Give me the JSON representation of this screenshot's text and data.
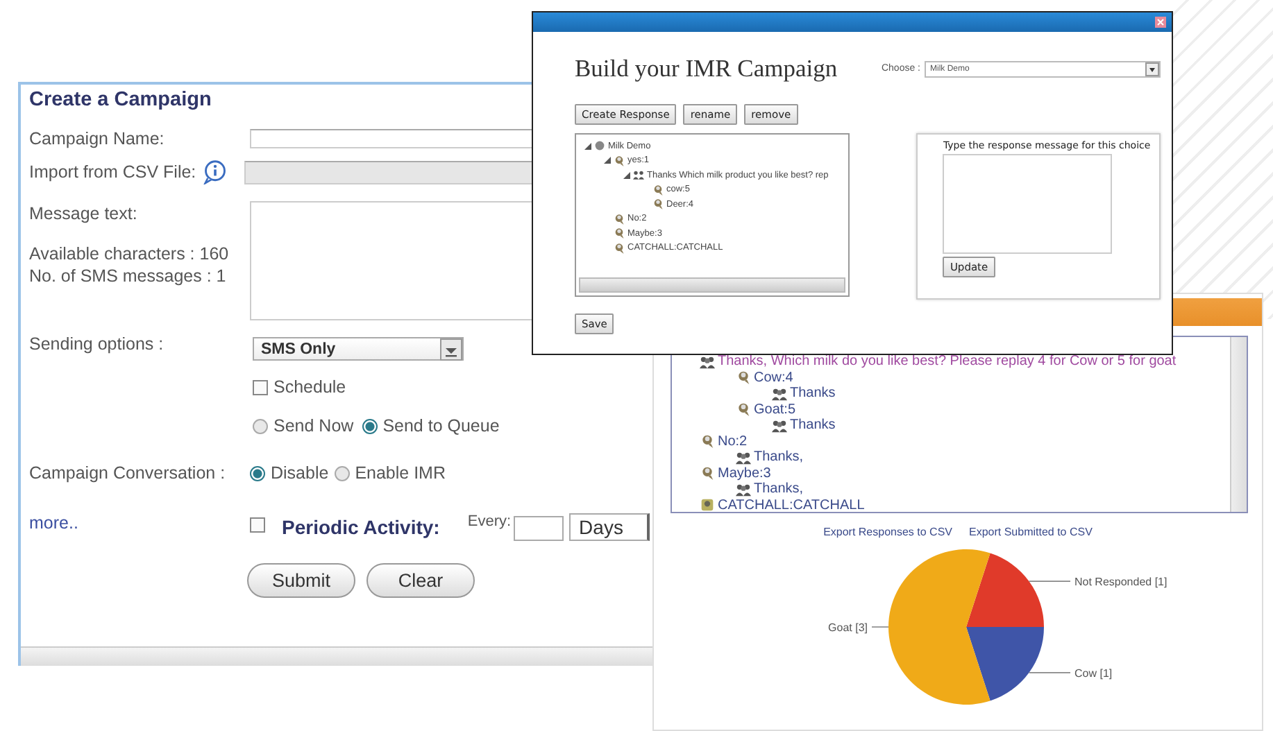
{
  "campaign_form": {
    "title": "Create a Campaign",
    "campaign_name": {
      "label": "Campaign Name:"
    },
    "import_csv": {
      "label": "Import from CSV File:"
    },
    "message": {
      "label": "Message text:",
      "available": "Available characters : 160",
      "sms_count": "No. of SMS messages : 1"
    },
    "sending_options": {
      "label": "Sending options :",
      "value": "SMS Only"
    },
    "schedule": {
      "label": "Schedule",
      "checked": false
    },
    "send_mode": [
      {
        "label": "Send Now",
        "selected": false
      },
      {
        "label": "Send to Queue",
        "selected": true
      }
    ],
    "conversation": {
      "label": "Campaign Conversation :",
      "options": [
        {
          "label": "Disable",
          "selected": true
        },
        {
          "label": "Enable IMR",
          "selected": false
        }
      ]
    },
    "more_link": "more..",
    "periodic": {
      "label": "Periodic Activity:",
      "checked": false,
      "every_label": "Every:",
      "unit": "Days"
    },
    "buttons": [
      "Submit",
      "Clear"
    ]
  },
  "imr_dialog": {
    "title": "Build your IMR Campaign",
    "choose_label": "Choose :",
    "choose_value": "Milk Demo",
    "buttons": [
      "Create Response",
      "rename",
      "remove"
    ],
    "tree": [
      {
        "label": "Milk Demo",
        "kind": "root",
        "children": [
          {
            "label": "yes:1",
            "kind": "choice",
            "children": [
              {
                "label": "Thanks Which milk product you like best? rep",
                "kind": "response",
                "children": [
                  {
                    "label": "cow:5",
                    "kind": "choice"
                  },
                  {
                    "label": "Deer:4",
                    "kind": "choice"
                  }
                ]
              }
            ]
          },
          {
            "label": "No:2",
            "kind": "choice"
          },
          {
            "label": "Maybe:3",
            "kind": "choice"
          },
          {
            "label": "CATCHALL:CATCHALL",
            "kind": "choice"
          }
        ]
      }
    ],
    "response_label": "Type the response message for this choice",
    "update_button": "Update",
    "save_button": "Save"
  },
  "results": {
    "tree": [
      {
        "label": "Thanks, Which milk do you like best? Please replay 4 for Cow or 5 for goat",
        "kind": "response",
        "highlight": true,
        "children": [
          {
            "label": "Cow:4",
            "kind": "choice",
            "children": [
              {
                "label": "Thanks",
                "kind": "response"
              }
            ]
          },
          {
            "label": "Goat:5",
            "kind": "choice",
            "children": [
              {
                "label": "Thanks",
                "kind": "response"
              }
            ]
          }
        ]
      },
      {
        "label": "No:2",
        "kind": "choice",
        "children": [
          {
            "label": "Thanks,",
            "kind": "response"
          }
        ]
      },
      {
        "label": "Maybe:3",
        "kind": "choice",
        "children": [
          {
            "label": "Thanks,",
            "kind": "response"
          }
        ]
      },
      {
        "label": "CATCHALL:CATCHALL",
        "kind": "catchall"
      }
    ],
    "export_links": [
      "Export Responses to CSV",
      "Export Submitted to CSV"
    ],
    "chart_data": {
      "type": "pie",
      "categories": [
        "Not Responded [1]",
        "Cow [1]",
        "Goat [3]"
      ],
      "values": [
        1,
        1,
        3
      ],
      "colors": [
        "#e03a2a",
        "#3f55a8",
        "#f0aa18"
      ]
    }
  }
}
